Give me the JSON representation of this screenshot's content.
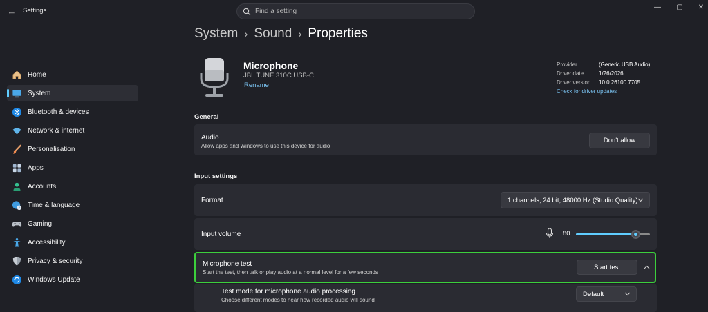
{
  "window": {
    "title": "Settings",
    "minimize_glyph": "—",
    "maximize_glyph": "▢",
    "close_glyph": "✕"
  },
  "search": {
    "placeholder": "Find a setting"
  },
  "sidebar": {
    "items": [
      {
        "label": "Home",
        "icon": "home-icon",
        "active": false
      },
      {
        "label": "System",
        "icon": "monitor-icon",
        "active": true
      },
      {
        "label": "Bluetooth & devices",
        "icon": "bluetooth-icon",
        "active": false
      },
      {
        "label": "Network & internet",
        "icon": "wifi-icon",
        "active": false
      },
      {
        "label": "Personalisation",
        "icon": "brush-icon",
        "active": false
      },
      {
        "label": "Apps",
        "icon": "apps-icon",
        "active": false
      },
      {
        "label": "Accounts",
        "icon": "person-icon",
        "active": false
      },
      {
        "label": "Time & language",
        "icon": "globe-clock-icon",
        "active": false
      },
      {
        "label": "Gaming",
        "icon": "controller-icon",
        "active": false
      },
      {
        "label": "Accessibility",
        "icon": "accessibility-icon",
        "active": false
      },
      {
        "label": "Privacy & security",
        "icon": "shield-icon",
        "active": false
      },
      {
        "label": "Windows Update",
        "icon": "update-icon",
        "active": false
      }
    ]
  },
  "breadcrumb": {
    "part1": "System",
    "part2": "Sound",
    "current": "Properties",
    "separator": "›"
  },
  "device": {
    "name": "Microphone",
    "model": "JBL TUNE 310C USB-C",
    "rename_label": "Rename",
    "provider_label": "Provider",
    "provider_value": "(Generic USB Audio)",
    "driver_date_label": "Driver date",
    "driver_date_value": "1/26/2026",
    "driver_version_label": "Driver version",
    "driver_version_value": "10.0.26100.7705",
    "driver_updates_link": "Check for driver updates"
  },
  "general": {
    "heading": "General",
    "audio_title": "Audio",
    "audio_desc": "Allow apps and Windows to use this device for audio",
    "audio_button": "Don't allow"
  },
  "input_settings": {
    "heading": "Input settings",
    "format_label": "Format",
    "format_value": "1 channels, 24 bit, 48000 Hz (Studio Quality)",
    "volume_label": "Input volume",
    "volume_value": "80",
    "volume_level": 0.8,
    "mic_test_title": "Microphone test",
    "mic_test_desc": "Start the test, then talk or play audio at a normal level for a few seconds",
    "start_test_button": "Start test",
    "test_mode_title": "Test mode for microphone audio processing",
    "test_mode_desc": "Choose different modes to hear how recorded audio will sound",
    "test_mode_value": "Default"
  },
  "colors": {
    "accent": "#60cdff",
    "highlight_border": "#3ccf3c",
    "background": "#1f2026",
    "card": "#2a2b32"
  }
}
